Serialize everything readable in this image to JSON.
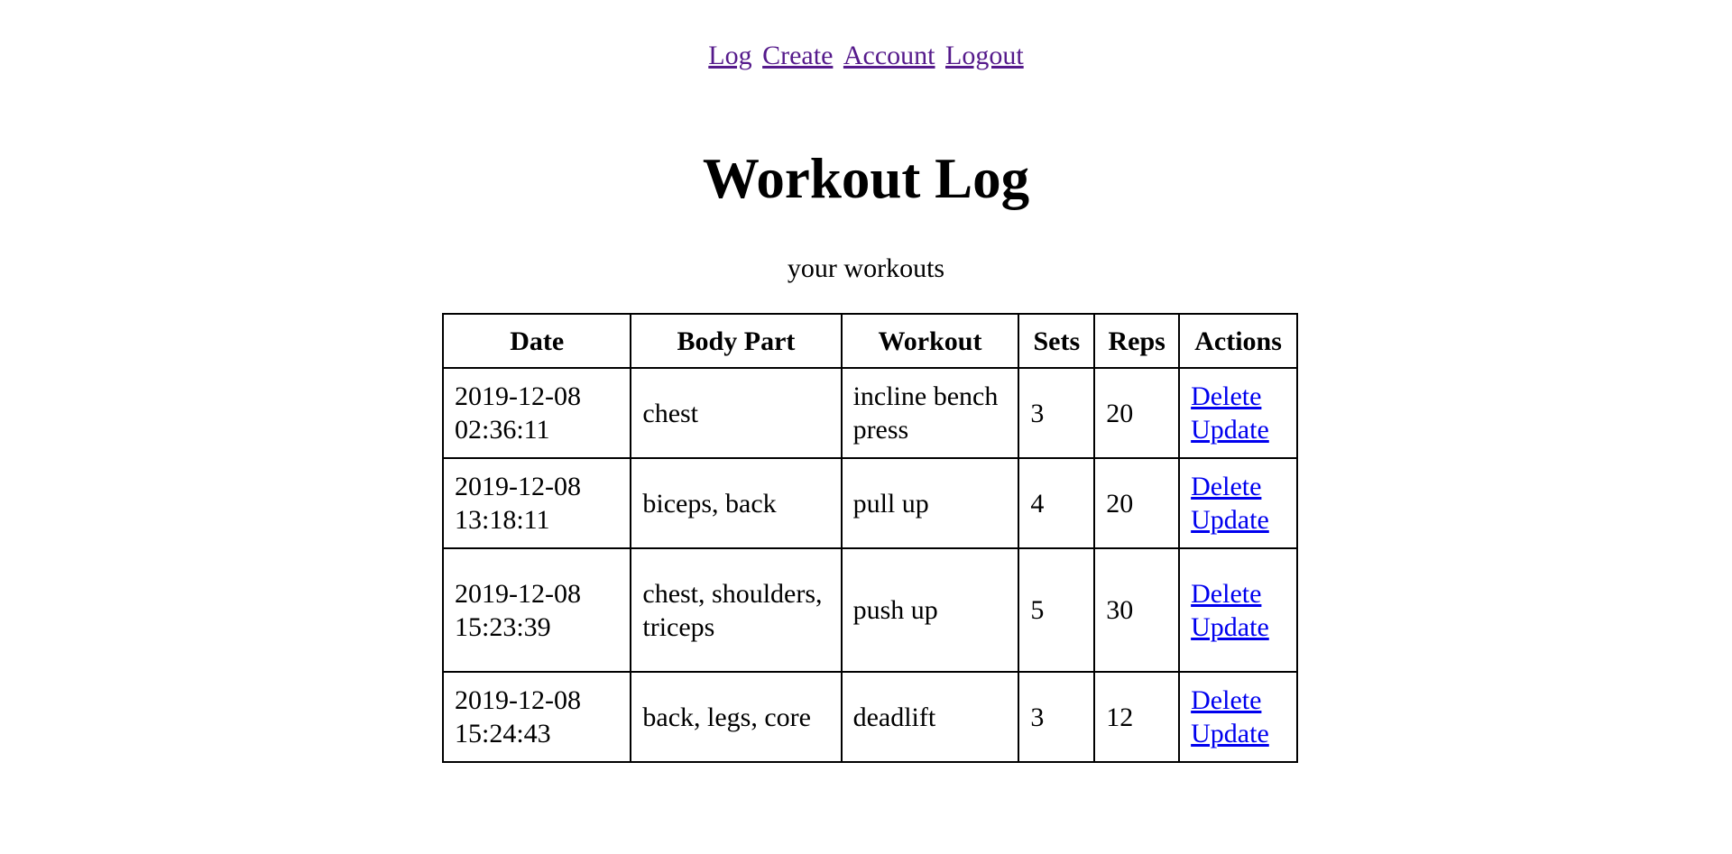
{
  "nav": {
    "links": [
      "Log",
      "Create",
      "Account",
      "Logout"
    ]
  },
  "page": {
    "title": "Workout Log",
    "subtitle": "your workouts"
  },
  "table": {
    "headers": [
      "Date",
      "Body Part",
      "Workout",
      "Sets",
      "Reps",
      "Actions"
    ],
    "rows": [
      {
        "date_day": "2019-12-08",
        "date_time": "02:36:11",
        "body_part": "chest",
        "workout": "incline bench press",
        "sets": "3",
        "reps": "20",
        "delete_label": "Delete",
        "update_label": "Update"
      },
      {
        "date_day": "2019-12-08",
        "date_time": "13:18:11",
        "body_part": "biceps, back",
        "workout": "pull up",
        "sets": "4",
        "reps": "20",
        "delete_label": "Delete",
        "update_label": "Update"
      },
      {
        "date_day": "2019-12-08",
        "date_time": "15:23:39",
        "body_part": "chest, shoulders, triceps",
        "workout": "push up",
        "sets": "5",
        "reps": "30",
        "delete_label": "Delete",
        "update_label": "Update"
      },
      {
        "date_day": "2019-12-08",
        "date_time": "15:24:43",
        "body_part": "back, legs, core",
        "workout": "deadlift",
        "sets": "3",
        "reps": "12",
        "delete_label": "Delete",
        "update_label": "Update"
      }
    ]
  },
  "colors": {
    "visited_link": "#551a8b",
    "link": "#0000ee",
    "text": "#000000",
    "background": "#ffffff"
  }
}
